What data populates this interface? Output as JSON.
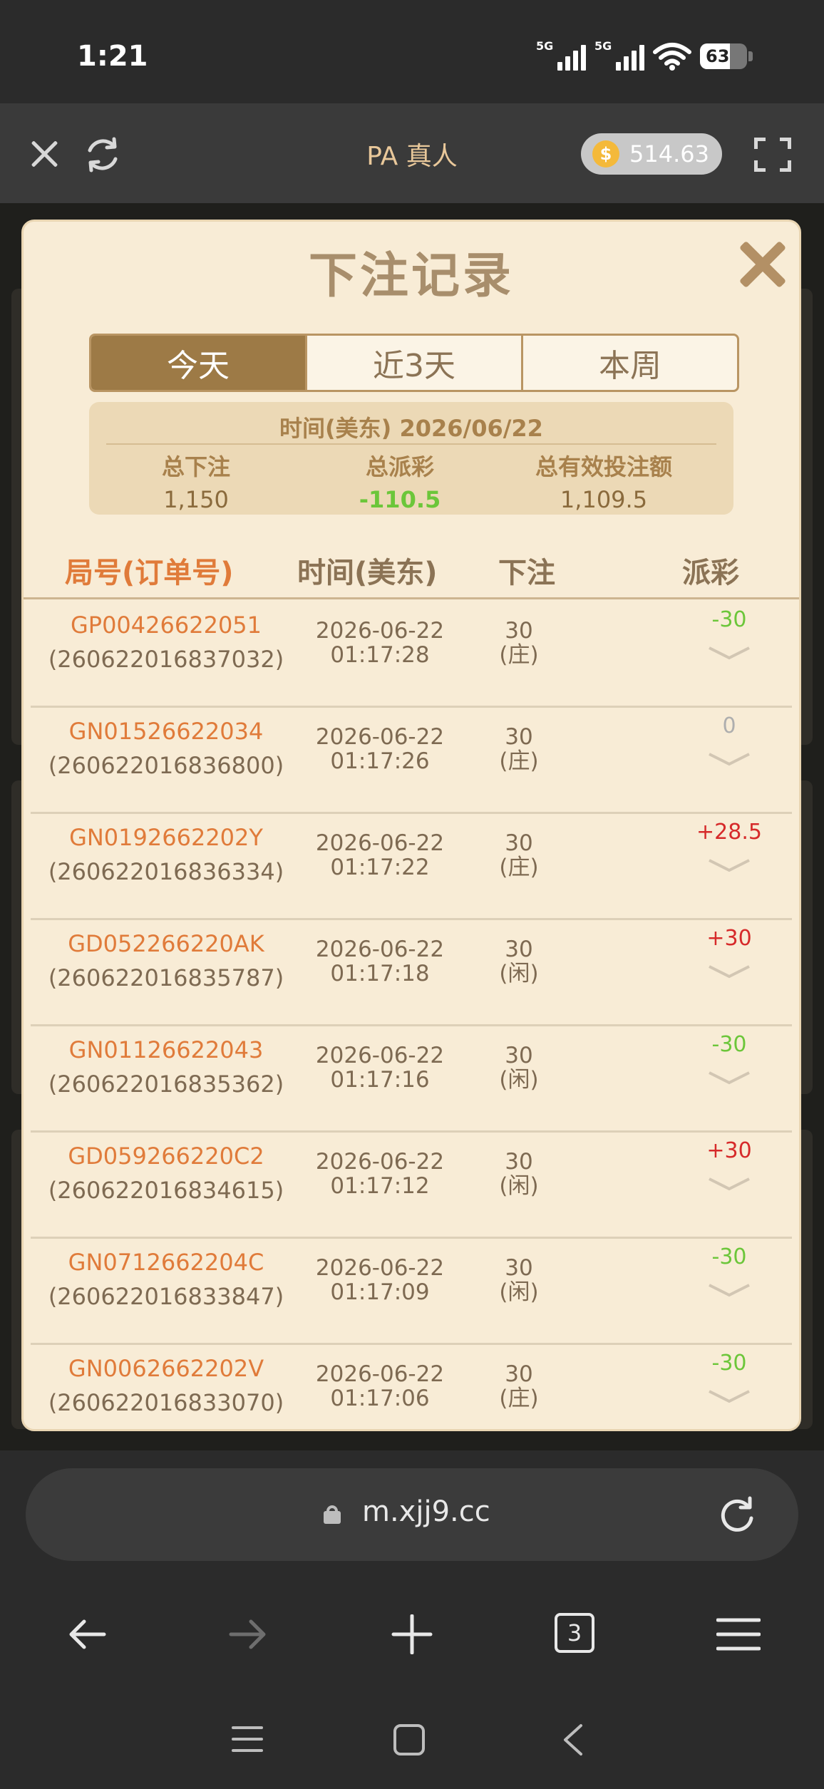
{
  "status": {
    "time": "1:21",
    "net1": "5G",
    "net2": "5G",
    "battery": "63"
  },
  "header": {
    "title": "PA 真人",
    "balance": "514.63",
    "coin_symbol": "$"
  },
  "modal": {
    "title": "下注记录",
    "tabs": [
      "今天",
      "近3天",
      "本周"
    ],
    "summary": {
      "date_label": "时间(美东) 2026/06/22",
      "total_bet_label": "总下注",
      "total_bet": "1,150",
      "total_payout_label": "总派彩",
      "total_payout": "-110.5",
      "valid_bet_label": "总有效投注额",
      "valid_bet": "1,109.5"
    },
    "columns": {
      "order": "局号(订单号)",
      "time": "时间(美东)",
      "bet": "下注",
      "payout": "派彩"
    },
    "rows": [
      {
        "game_id": "GP00426622051",
        "order_id": "(260622016837032)",
        "date": "2026-06-22",
        "time": "01:17:28",
        "amount": "30",
        "side": "(庄)",
        "payout": "-30",
        "kind": "loss"
      },
      {
        "game_id": "GN01526622034",
        "order_id": "(260622016836800)",
        "date": "2026-06-22",
        "time": "01:17:26",
        "amount": "30",
        "side": "(庄)",
        "payout": "0",
        "kind": "zero"
      },
      {
        "game_id": "GN0192662202Y",
        "order_id": "(260622016836334)",
        "date": "2026-06-22",
        "time": "01:17:22",
        "amount": "30",
        "side": "(庄)",
        "payout": "+28.5",
        "kind": "win"
      },
      {
        "game_id": "GD052266220AK",
        "order_id": "(260622016835787)",
        "date": "2026-06-22",
        "time": "01:17:18",
        "amount": "30",
        "side": "(闲)",
        "payout": "+30",
        "kind": "win"
      },
      {
        "game_id": "GN01126622043",
        "order_id": "(260622016835362)",
        "date": "2026-06-22",
        "time": "01:17:16",
        "amount": "30",
        "side": "(闲)",
        "payout": "-30",
        "kind": "loss"
      },
      {
        "game_id": "GD059266220C2",
        "order_id": "(260622016834615)",
        "date": "2026-06-22",
        "time": "01:17:12",
        "amount": "30",
        "side": "(闲)",
        "payout": "+30",
        "kind": "win"
      },
      {
        "game_id": "GN0712662204C",
        "order_id": "(260622016833847)",
        "date": "2026-06-22",
        "time": "01:17:09",
        "amount": "30",
        "side": "(闲)",
        "payout": "-30",
        "kind": "loss"
      },
      {
        "game_id": "GN0062662202V",
        "order_id": "(260622016833070)",
        "date": "2026-06-22",
        "time": "01:17:06",
        "amount": "30",
        "side": "(庄)",
        "payout": "-30",
        "kind": "loss"
      }
    ]
  },
  "browser": {
    "url": "m.xjj9.cc",
    "tab_count": "3"
  },
  "colors": {
    "accent": "#9d7a46",
    "win": "#d62a2a",
    "loss": "#6cc63a",
    "order": "#e07b3a"
  }
}
